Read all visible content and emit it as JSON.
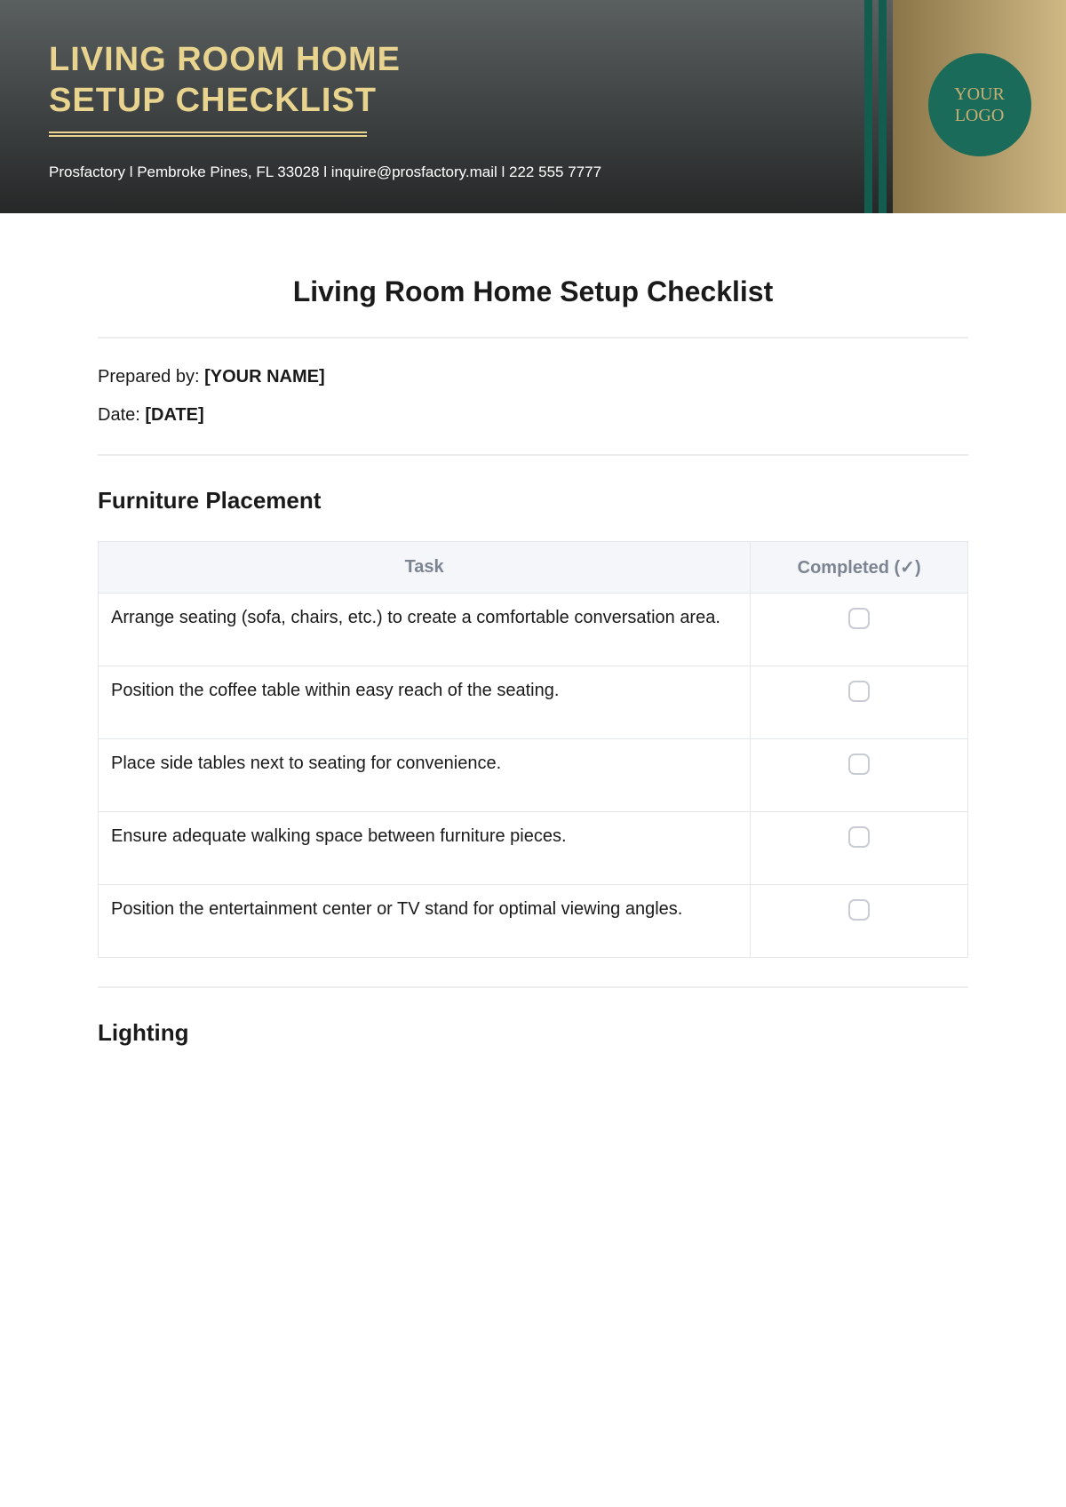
{
  "header": {
    "title_line1": "LIVING ROOM HOME",
    "title_line2": "SETUP CHECKLIST",
    "info": "Prosfactory  l  Pembroke Pines, FL 33028 l  inquire@prosfactory.mail l 222 555 7777",
    "logo_line1": "YOUR",
    "logo_line2": "LOGO"
  },
  "document": {
    "title": "Living Room Home Setup Checklist",
    "prepared_label": "Prepared by: ",
    "prepared_value": "[YOUR NAME]",
    "date_label": "Date: ",
    "date_value": "[DATE]"
  },
  "sections": [
    {
      "title": "Furniture Placement",
      "columns": {
        "task": "Task",
        "completed": "Completed (✓)"
      },
      "tasks": [
        "Arrange seating (sofa, chairs, etc.) to create a comfortable conversation area.",
        "Position the coffee table within easy reach of the seating.",
        "Place side tables next to seating for convenience.",
        "Ensure adequate walking space between furniture pieces.",
        "Position the entertainment center or TV stand for optimal viewing angles."
      ]
    },
    {
      "title": "Lighting"
    }
  ]
}
